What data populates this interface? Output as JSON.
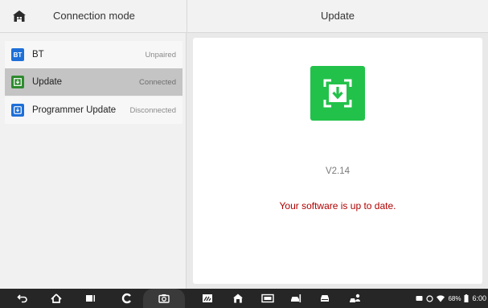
{
  "header": {
    "left_title": "Connection mode",
    "right_title": "Update"
  },
  "sidebar": {
    "items": [
      {
        "badge": "BT",
        "label": "BT",
        "status": "Unpaired",
        "icon": "bluetooth-badge"
      },
      {
        "badge": "",
        "label": "Update",
        "status": "Connected",
        "icon": "update-badge"
      },
      {
        "badge": "",
        "label": "Programmer Update",
        "status": "Disconnected",
        "icon": "programmer-badge"
      }
    ]
  },
  "main": {
    "version": "V2.14",
    "message": "Your software is up to date."
  },
  "statusbar": {
    "battery": "68%",
    "time": "6:00"
  },
  "colors": {
    "accent_blue": "#1e6fd8",
    "accent_green": "#22c24a",
    "status_red": "#b00000"
  }
}
